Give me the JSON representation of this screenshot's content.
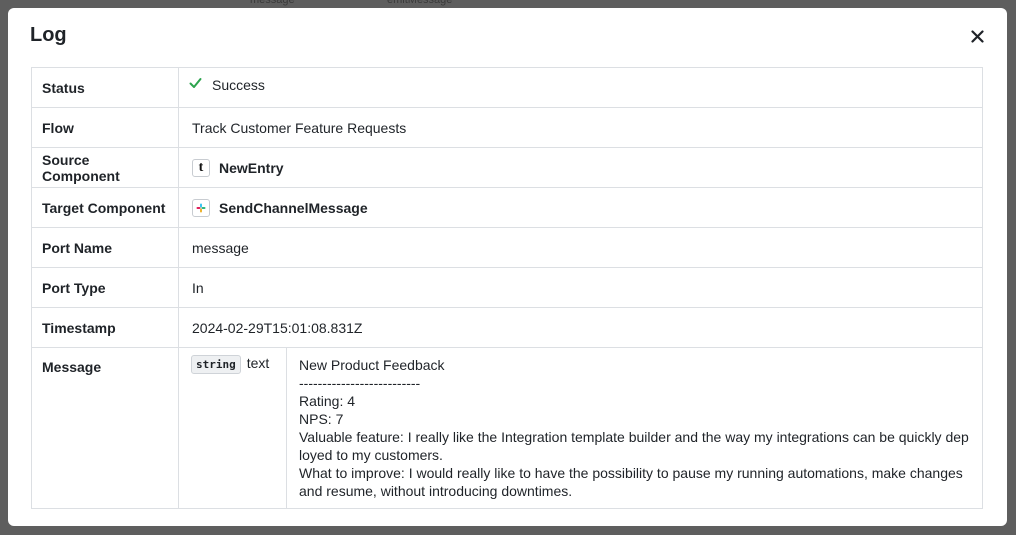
{
  "backdrop": {
    "hint_left": "message",
    "hint_right": "emitMessage"
  },
  "modal": {
    "title": "Log"
  },
  "rows": {
    "status": {
      "label": "Status",
      "value": "Success"
    },
    "flow": {
      "label": "Flow",
      "value": "Track Customer Feature Requests"
    },
    "source": {
      "label": "Source Component",
      "icon": "t",
      "value": "NewEntry"
    },
    "target": {
      "label": "Target Component",
      "icon": "slack-icon",
      "value": "SendChannelMessage"
    },
    "port_name": {
      "label": "Port Name",
      "value": "message"
    },
    "port_type": {
      "label": "Port Type",
      "value": "In"
    },
    "timestamp": {
      "label": "Timestamp",
      "value": "2024-02-29T15:01:08.831Z"
    },
    "message": {
      "label": "Message",
      "type_badge": "string",
      "type_text": "text",
      "body": "New Product Feedback\n--------------------------\nRating: 4\nNPS: 7\nValuable feature: I really like the Integration template builder and the way my integrations can be quickly deployed to my customers.\nWhat to improve: I would really like to have the possibility to pause my running automations, make changes and resume, without introducing downtimes."
    }
  },
  "colors": {
    "success": "#2da44e",
    "backdrop": "#5e5e5e",
    "border": "#dcdfe3"
  }
}
